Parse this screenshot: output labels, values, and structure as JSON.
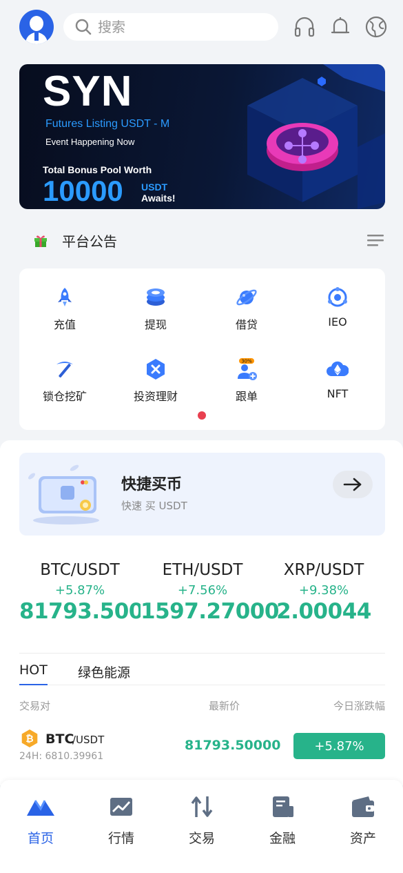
{
  "header": {
    "search_placeholder": "搜索",
    "icons": [
      "headset-icon",
      "bell-icon",
      "globe-icon"
    ]
  },
  "banner": {
    "title": "SYN",
    "subtitle": "Futures Listing USDT - M",
    "event": "Event Happening Now",
    "bonus_label": "Total Bonus Pool Worth",
    "bonus_amount": "10000",
    "bonus_unit": "USDT",
    "bonus_suffix": "Awaits!"
  },
  "notice": {
    "title": "平台公告"
  },
  "quick_grid": {
    "items": [
      {
        "label": "充值",
        "icon": "rocket-icon"
      },
      {
        "label": "提现",
        "icon": "coin-stack-icon"
      },
      {
        "label": "借贷",
        "icon": "planet-icon"
      },
      {
        "label": "IEO",
        "icon": "ieo-icon"
      },
      {
        "label": "锁仓挖矿",
        "icon": "pickaxe-icon"
      },
      {
        "label": "投资理财",
        "icon": "invest-icon"
      },
      {
        "label": "跟单",
        "icon": "copy-trade-icon",
        "badge": "30%"
      },
      {
        "label": "NFT",
        "icon": "nft-cloud-icon"
      }
    ]
  },
  "quick_buy": {
    "title": "快捷买币",
    "subtitle": "快速 买 USDT"
  },
  "tickers": [
    {
      "pair": "BTC/USDT",
      "change": "+5.87%",
      "price": "81793.50000"
    },
    {
      "pair": "ETH/USDT",
      "change": "+7.56%",
      "price": "1597.27000"
    },
    {
      "pair": "XRP/USDT",
      "change": "+9.38%",
      "price": "2.00044"
    }
  ],
  "market": {
    "tabs": [
      "HOT",
      "绿色能源"
    ],
    "columns": [
      "交易对",
      "最新价",
      "今日涨跌幅"
    ],
    "rows": [
      {
        "base": "BTC",
        "quote": "/USDT",
        "volume": "24H: 6810.39961",
        "price": "81793.50000",
        "change": "+5.87%"
      }
    ]
  },
  "nav": {
    "items": [
      {
        "label": "首页",
        "active": true
      },
      {
        "label": "行情"
      },
      {
        "label": "交易"
      },
      {
        "label": "金融"
      },
      {
        "label": "资产"
      }
    ]
  },
  "colors": {
    "accent": "#2a63e6",
    "up": "#27b38a",
    "dot": "#e8404f"
  }
}
